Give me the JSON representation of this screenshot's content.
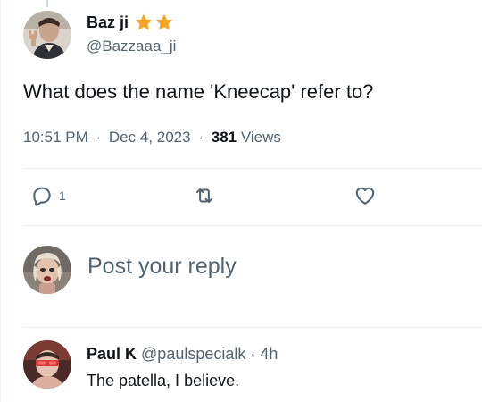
{
  "tweet": {
    "author": {
      "display_name": "Baz ji",
      "badges": [
        "star-icon",
        "star-icon"
      ],
      "handle": "@Bazzaaa_ji"
    },
    "text": "What does the name 'Kneecap' refer to?",
    "time": "10:51 PM",
    "date": "Dec 4, 2023",
    "separator": "·",
    "views_count": "381",
    "views_label": "Views",
    "actions": {
      "reply_count": "1",
      "retweet_count": "",
      "like_count": ""
    }
  },
  "composer": {
    "placeholder": "Post your reply"
  },
  "reply": {
    "display_name": "Paul K",
    "handle": "@paulspecialk",
    "separator": "·",
    "time": "4h",
    "text": "The patella, I believe."
  },
  "colors": {
    "text_primary": "#0f1419",
    "text_secondary": "#536471",
    "star": "#f5a623",
    "divider": "#eff3f4"
  }
}
